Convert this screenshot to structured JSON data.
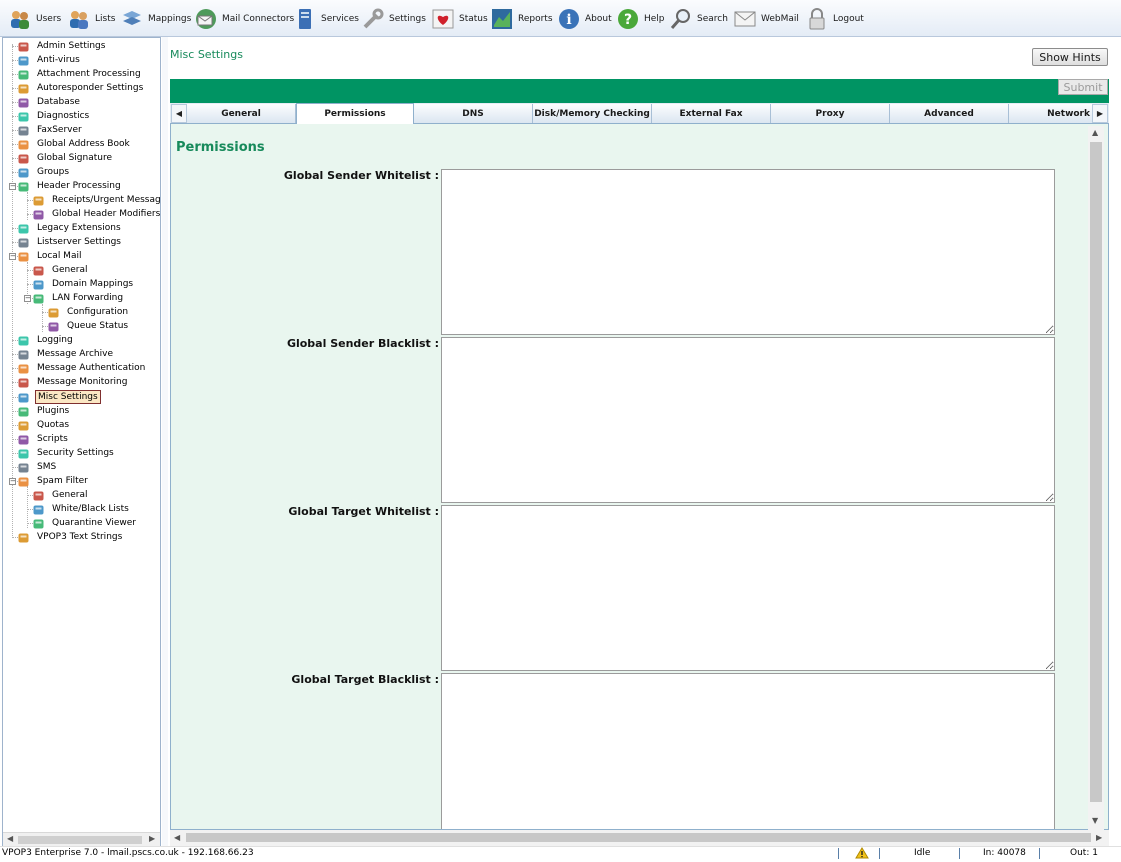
{
  "toolbar": {
    "items": [
      {
        "label": "Users",
        "icon": "users-icon"
      },
      {
        "label": "Lists",
        "icon": "lists-icon"
      },
      {
        "label": "Mappings",
        "icon": "mappings-icon"
      },
      {
        "label": "Mail Connectors",
        "icon": "mail-connectors-icon"
      },
      {
        "label": "Services",
        "icon": "services-icon"
      },
      {
        "label": "Settings",
        "icon": "settings-icon"
      },
      {
        "label": "Status",
        "icon": "status-icon"
      },
      {
        "label": "Reports",
        "icon": "reports-icon"
      },
      {
        "label": "About",
        "icon": "about-icon"
      },
      {
        "label": "Help",
        "icon": "help-icon"
      },
      {
        "label": "Search",
        "icon": "search-icon"
      },
      {
        "label": "WebMail",
        "icon": "webmail-icon"
      },
      {
        "label": "Logout",
        "icon": "logout-icon"
      }
    ]
  },
  "tree": {
    "items": [
      {
        "label": "Admin Settings",
        "icon": "admin-icon"
      },
      {
        "label": "Anti-virus",
        "icon": "antivirus-icon"
      },
      {
        "label": "Attachment Processing",
        "icon": "attachment-icon"
      },
      {
        "label": "Autoresponder Settings",
        "icon": "autoresponder-icon"
      },
      {
        "label": "Database",
        "icon": "database-icon"
      },
      {
        "label": "Diagnostics",
        "icon": "diagnostics-icon"
      },
      {
        "label": "FaxServer",
        "icon": "fax-icon"
      },
      {
        "label": "Global Address Book",
        "icon": "address-book-icon"
      },
      {
        "label": "Global Signature",
        "icon": "signature-icon"
      },
      {
        "label": "Groups",
        "icon": "groups-icon"
      },
      {
        "label": "Header Processing",
        "icon": "header-icon"
      },
      {
        "label": "Receipts/Urgent Messages",
        "icon": "receipts-icon"
      },
      {
        "label": "Global Header Modifiers",
        "icon": "header-modifiers-icon"
      },
      {
        "label": "Legacy Extensions",
        "icon": "extensions-icon"
      },
      {
        "label": "Listserver Settings",
        "icon": "listserver-icon"
      },
      {
        "label": "Local Mail",
        "icon": "local-mail-icon"
      },
      {
        "label": "General",
        "icon": "general-icon"
      },
      {
        "label": "Domain Mappings",
        "icon": "domain-mappings-icon"
      },
      {
        "label": "LAN Forwarding",
        "icon": "lan-forwarding-icon"
      },
      {
        "label": "Configuration",
        "icon": "configuration-icon"
      },
      {
        "label": "Queue Status",
        "icon": "queue-status-icon"
      },
      {
        "label": "Logging",
        "icon": "logging-icon"
      },
      {
        "label": "Message Archive",
        "icon": "archive-icon"
      },
      {
        "label": "Message Authentication",
        "icon": "authentication-icon"
      },
      {
        "label": "Message Monitoring",
        "icon": "monitoring-icon"
      },
      {
        "label": "Misc Settings",
        "icon": "misc-settings-icon"
      },
      {
        "label": "Plugins",
        "icon": "plugins-icon"
      },
      {
        "label": "Quotas",
        "icon": "quotas-icon"
      },
      {
        "label": "Scripts",
        "icon": "scripts-icon"
      },
      {
        "label": "Security Settings",
        "icon": "security-icon"
      },
      {
        "label": "SMS",
        "icon": "sms-icon"
      },
      {
        "label": "Spam Filter",
        "icon": "spam-filter-icon"
      },
      {
        "label": "General",
        "icon": "general-icon"
      },
      {
        "label": "White/Black Lists",
        "icon": "white-black-lists-icon"
      },
      {
        "label": "Quarantine Viewer",
        "icon": "quarantine-icon"
      },
      {
        "label": "VPOP3 Text Strings",
        "icon": "text-strings-icon"
      }
    ],
    "selected": "Misc Settings"
  },
  "main": {
    "page_title": "Misc Settings",
    "show_hints_label": "Show Hints",
    "submit_label": "Submit",
    "tabs": [
      "General",
      "Permissions",
      "DNS",
      "Disk/Memory Checking",
      "External Fax",
      "Proxy",
      "Advanced",
      "Network"
    ],
    "active_tab": "Permissions",
    "section_title": "Permissions",
    "fields": [
      {
        "label": "Global Sender Whitelist :",
        "value": ""
      },
      {
        "label": "Global Sender Blacklist :",
        "value": ""
      },
      {
        "label": "Global Target Whitelist :",
        "value": ""
      },
      {
        "label": "Global Target Blacklist :",
        "value": ""
      }
    ]
  },
  "status_bar": {
    "product": "VPOP3 Enterprise 7.0 - lmail.pscs.co.uk - 192.168.66.23",
    "warning_icon": "warning-icon",
    "state": "Idle",
    "in": "In: 40078",
    "out": "Out: 1"
  },
  "colors": {
    "accent_green": "#009463",
    "title_green": "#178a5b",
    "content_bg": "#e9f6ef"
  }
}
